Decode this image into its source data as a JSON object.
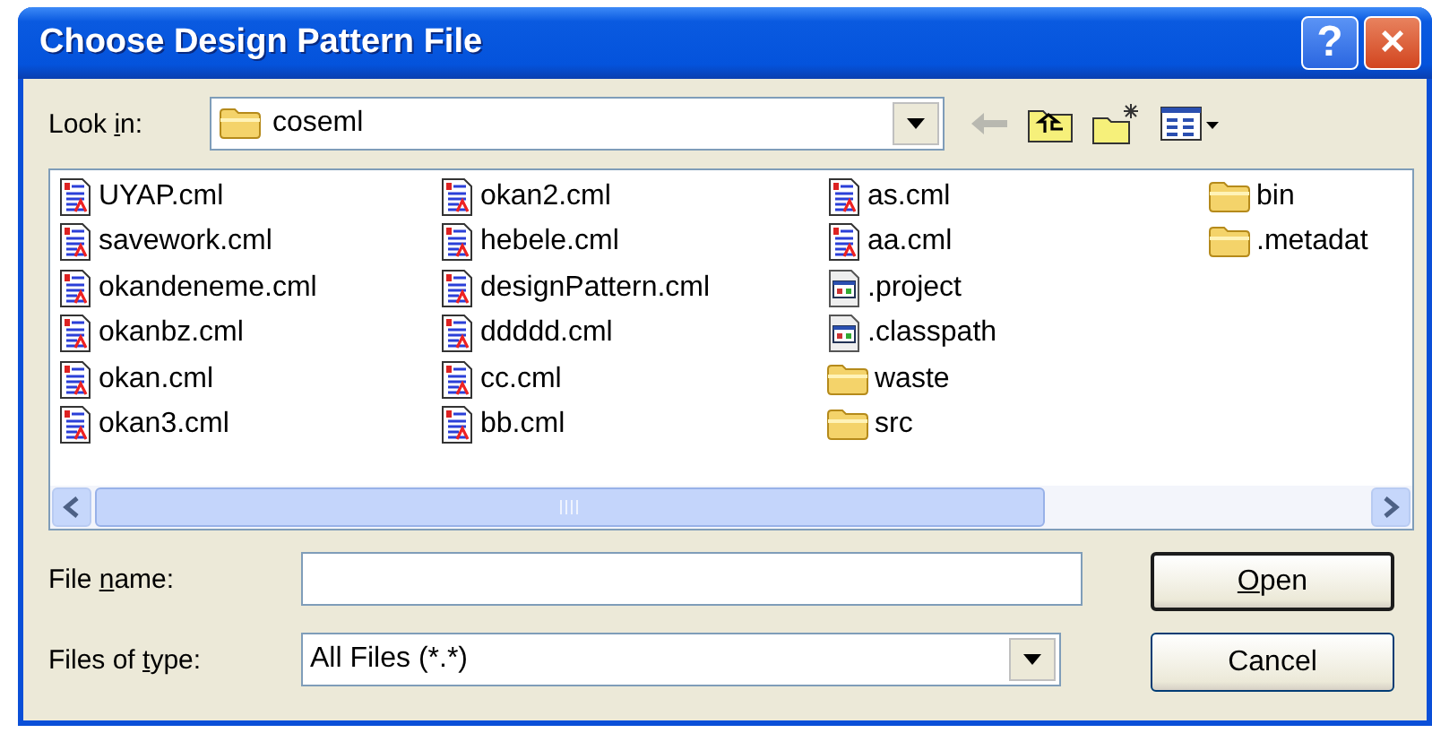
{
  "window": {
    "title": "Choose Design Pattern File",
    "help_button": "?",
    "close_button": "×"
  },
  "look_in": {
    "label_parts": [
      {
        "text": "Look ",
        "underlined": false
      },
      {
        "text": "i",
        "underlined": true
      },
      {
        "text": "n:",
        "underlined": false
      }
    ],
    "value": "coseml"
  },
  "files": [
    {
      "name": "UYAP.cml",
      "kind": "cml"
    },
    {
      "name": "savework.cml",
      "kind": "cml"
    },
    {
      "name": "okandeneme.cml",
      "kind": "cml"
    },
    {
      "name": "okanbz.cml",
      "kind": "cml"
    },
    {
      "name": "okan.cml",
      "kind": "cml"
    },
    {
      "name": "okan3.cml",
      "kind": "cml"
    },
    {
      "name": "okan2.cml",
      "kind": "cml"
    },
    {
      "name": "hebele.cml",
      "kind": "cml"
    },
    {
      "name": "designPattern.cml",
      "kind": "cml"
    },
    {
      "name": "ddddd.cml",
      "kind": "cml"
    },
    {
      "name": "cc.cml",
      "kind": "cml"
    },
    {
      "name": "bb.cml",
      "kind": "cml"
    },
    {
      "name": "as.cml",
      "kind": "cml"
    },
    {
      "name": "aa.cml",
      "kind": "cml"
    },
    {
      "name": ".project",
      "kind": "project"
    },
    {
      "name": ".classpath",
      "kind": "project"
    },
    {
      "name": "waste",
      "kind": "folder"
    },
    {
      "name": "src",
      "kind": "folder"
    },
    {
      "name": "bin",
      "kind": "folder"
    },
    {
      "name": ".metadat",
      "kind": "folder"
    }
  ],
  "file_name": {
    "label_parts": [
      {
        "text": "File ",
        "underlined": false
      },
      {
        "text": "n",
        "underlined": true
      },
      {
        "text": "ame:",
        "underlined": false
      }
    ]
  },
  "files_of_type": {
    "label_parts": [
      {
        "text": "Files of ",
        "underlined": false
      },
      {
        "text": "t",
        "underlined": true
      },
      {
        "text": "ype:",
        "underlined": false
      }
    ],
    "value": "All Files (*.*)"
  },
  "buttons": [
    {
      "label_parts": [
        {
          "text": "O",
          "underlined": true
        },
        {
          "text": "pen",
          "underlined": false
        }
      ],
      "default": true
    },
    {
      "label_parts": [
        {
          "text": "Cancel",
          "underlined": false
        }
      ],
      "default": false
    }
  ]
}
